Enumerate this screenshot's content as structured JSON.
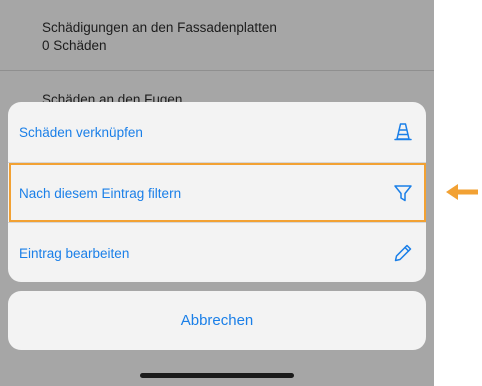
{
  "background_list": {
    "rows": [
      {
        "title": "Schädigungen an den Fassadenplatten",
        "subtitle": "0 Schäden"
      },
      {
        "title": "Schäden an den Fugen",
        "subtitle": ""
      }
    ]
  },
  "action_sheet": {
    "actions": [
      {
        "label": "Schäden verknüpfen",
        "icon": "traffic-cone-icon"
      },
      {
        "label": "Nach diesem Eintrag filtern",
        "icon": "filter-funnel-icon"
      },
      {
        "label": "Eintrag bearbeiten",
        "icon": "pencil-icon"
      }
    ],
    "cancel_label": "Abbrechen"
  },
  "colors": {
    "accent": "#1a7fe8",
    "highlight": "#f2a133",
    "dim_background": "#a6a6a6",
    "sheet_background": "#f3f3f3"
  }
}
